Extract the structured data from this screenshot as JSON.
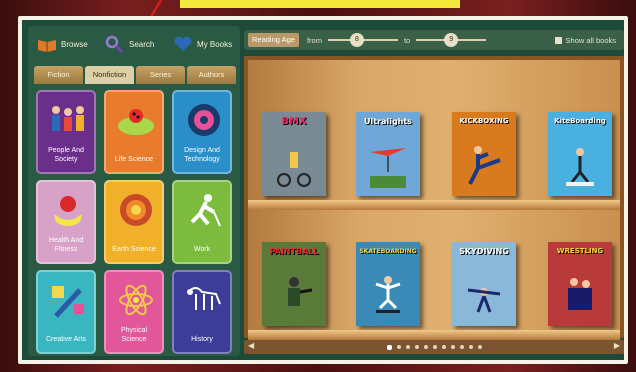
{
  "nav": {
    "browse": "Browse",
    "search": "Search",
    "my_books": "My Books"
  },
  "tabs": [
    "Fiction",
    "Nonfiction",
    "Series",
    "Authors"
  ],
  "active_tab": "Nonfiction",
  "categories": [
    {
      "label": "People And Society",
      "color": "#6a2f8a",
      "icon": "people-icon"
    },
    {
      "label": "Life Science",
      "color": "#e97b2c",
      "icon": "ladybug-leaf-icon"
    },
    {
      "label": "Design And Technology",
      "color": "#2a8fc9",
      "icon": "gear-disc-icon"
    },
    {
      "label": "Health And Fitness",
      "color": "#d8a2c8",
      "icon": "apple-measure-icon"
    },
    {
      "label": "Earth Science",
      "color": "#f1b02a",
      "icon": "earth-layers-icon"
    },
    {
      "label": "Work",
      "color": "#7dbb3f",
      "icon": "digging-worker-icon"
    },
    {
      "label": "Creative Arts",
      "color": "#3ab6c0",
      "icon": "paint-brush-icon"
    },
    {
      "label": "Physical Science",
      "color": "#e2569a",
      "icon": "atom-icon"
    },
    {
      "label": "History",
      "color": "#3b3d99",
      "icon": "dinosaur-skeleton-icon"
    }
  ],
  "filter": {
    "dropdown": "Reading Age",
    "from_label": "from",
    "from_value": "8",
    "to_label": "to",
    "to_value": "9",
    "show_all": "Show all books"
  },
  "books_top": [
    {
      "title": "BMX",
      "color": "#7a8a95"
    },
    {
      "title": "Ultralights",
      "color": "#6fa8d8"
    },
    {
      "title": "KICKBOXING",
      "color": "#d87a1e"
    },
    {
      "title": "KiteBoarding",
      "color": "#4ab0e0"
    }
  ],
  "books_bottom": [
    {
      "title": "PAINTBALL",
      "color": "#5a7a3a"
    },
    {
      "title": "SKATEBOARDING",
      "color": "#3a8ab8"
    },
    {
      "title": "SKYDIVING",
      "color": "#8ab8d8"
    },
    {
      "title": "WRESTLING",
      "color": "#b83a3a"
    }
  ],
  "pager": {
    "pages": 11,
    "active": 0
  }
}
